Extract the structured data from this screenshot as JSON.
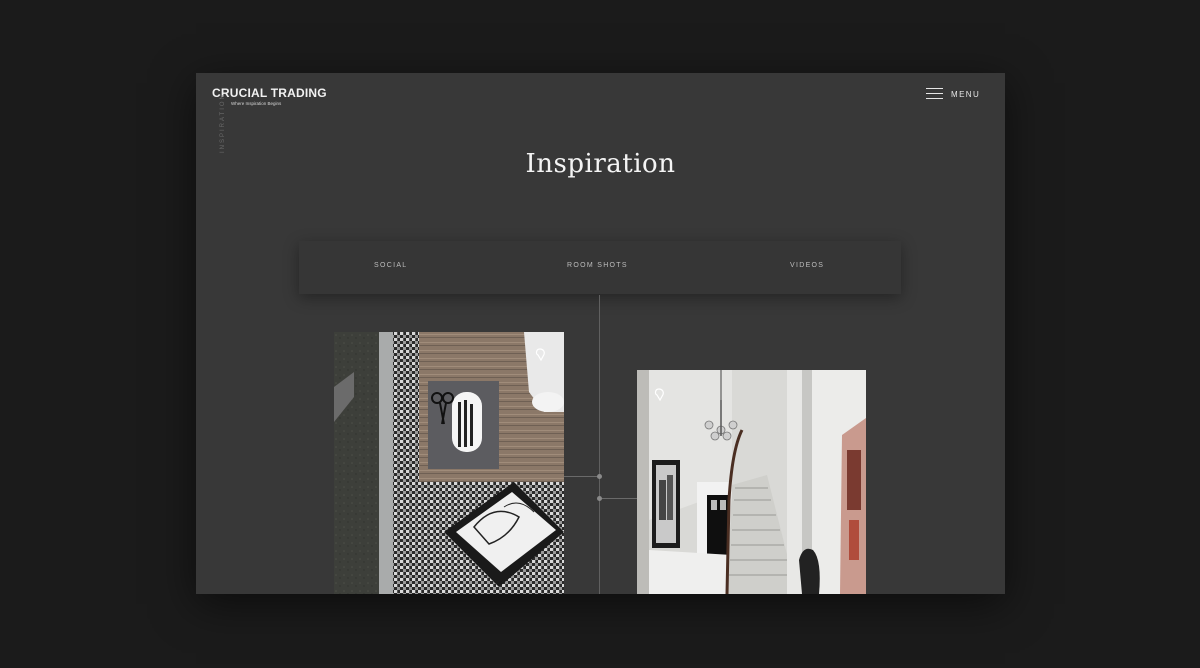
{
  "header": {
    "brand_title": "CRUCIAL TRADING",
    "brand_tagline": "Where Inspiration Begins",
    "menu_label": "MENU",
    "menu_icon": "hamburger-icon"
  },
  "side_label": "INSPIRATION",
  "page_title": "Inspiration",
  "tabs": [
    {
      "label": "SOCIAL"
    },
    {
      "label": "ROOM SHOTS"
    },
    {
      "label": "VIDEOS"
    }
  ],
  "gallery": [
    {
      "name": "flat-lay-rug-photo",
      "icon": "pin-icon"
    },
    {
      "name": "staircase-room-photo",
      "icon": "pin-icon"
    }
  ],
  "colors": {
    "page_bg": "#1b1b1b",
    "frame_bg": "#383838",
    "tab_bar_bg": "#363636",
    "text_primary": "#f4f4f4",
    "text_muted": "#bdbdbd"
  }
}
